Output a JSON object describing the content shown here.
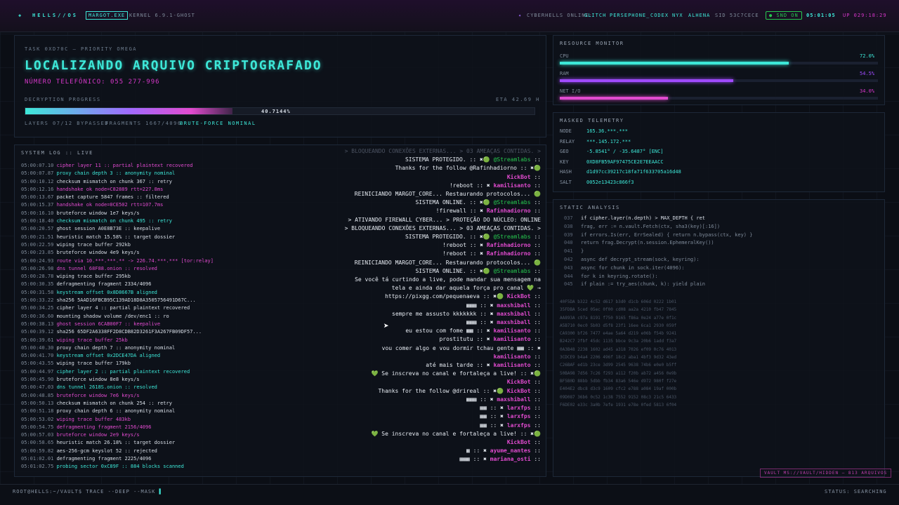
{
  "topbar": {
    "logo": "HELLS//OS",
    "app_badge": "MARGOT.EXE",
    "kernel": "KERNEL 6.9.1-GHOST",
    "online_label": "CYBERHELLS ONLINE:",
    "online_users": [
      "GLITCH",
      "PERSEPHONE_",
      "CODEX",
      "NYX",
      "ALHENA"
    ],
    "sid": "SID 53C7CECE",
    "snd": "SND ON",
    "clock": "05:01:05",
    "uptime": "UP 029:18:29"
  },
  "task": {
    "header": "TASK 0XD70C — PRIORITY OMEGA",
    "title": "LOCALIZANDO ARQUIVO CRIPTOGRAFADO",
    "phone": "NÚMERO TELEFÔNICO: 055 277-996",
    "progress_label": "DECRYPTION PROGRESS",
    "eta": "ETA 42.69 H",
    "progress_value": 40.7144,
    "progress_text": "40.7144%",
    "layers": "LAYERS 07/12 BYPASSED",
    "fragments": "FRAGMENTS 1667/4096",
    "status": "BRUTE-FORCE NOMINAL"
  },
  "log": {
    "header": "SYSTEM LOG :: LIVE",
    "lines": [
      [
        "05:00:07.10",
        "cipher layer 11 :: partial plaintext recovered",
        "mag"
      ],
      [
        "05:00:07.87",
        "proxy chain depth 3 :: anonymity nominal",
        "cyan"
      ],
      [
        "05:00:10.12",
        "checksum mismatch on chunk 367 :: retry",
        "w"
      ],
      [
        "05:00:12.16",
        "handshake ok node=C82889 rtt=227.8ms",
        "mag"
      ],
      [
        "05:00:13.67",
        "packet capture 5847 frames :: filtered",
        "w"
      ],
      [
        "05:00:15.37",
        "handshake ok node=0CE502 rtt=107.7ms",
        "mag"
      ],
      [
        "05:00:16.10",
        "bruteforce window 1e7 keys/s",
        "w"
      ],
      [
        "05:00:18.40",
        "checksum mismatch on chunk 495 :: retry",
        "cyan"
      ],
      [
        "05:00:20.57",
        "ghost session A0E8B73E :: keepalive",
        "w"
      ],
      [
        "05:00:21.51",
        "heuristic match 15.58% :: target dossier",
        "w"
      ],
      [
        "05:00:22.59",
        "wiping trace buffer 292kb",
        "w"
      ],
      [
        "05:00:23.85",
        "bruteforce window 4e9 keys/s",
        "w"
      ],
      [
        "05:00:24.93",
        "route via 10.***.***.** -> 226.74.***.*** [tor:relay]",
        "mag"
      ],
      [
        "05:00:26.98",
        "dns tunnel 68F88.onion :: resolved",
        "mag"
      ],
      [
        "05:00:28.78",
        "wiping trace buffer 295kb",
        "w"
      ],
      [
        "05:00:30.35",
        "defragmenting fragment 2334/4096",
        "w"
      ],
      [
        "05:00:31.58",
        "keystream offset 0x8D8667B aligned",
        "cyan"
      ],
      [
        "05:00:33.22",
        "sha256 5AAD16FBCB95C139AD18D8A3505756491D67C...",
        "w"
      ],
      [
        "05:00:34.25",
        "cipher layer 4 :: partial plaintext recovered",
        "w"
      ],
      [
        "05:00:36.60",
        "mounting shadow volume /dev/enc1 :: ro",
        "w"
      ],
      [
        "05:00:38.13",
        "ghost session 6CAB00F7 :: keepalive",
        "mag"
      ],
      [
        "05:00:39.12",
        "sha256 65DF2A6338FF2D8CDB82D3261F3A267FB09DF57...",
        "w"
      ],
      [
        "05:00:39.61",
        "wiping trace buffer 25kb",
        "mag"
      ],
      [
        "05:00:40.30",
        "proxy chain depth 7 :: anonymity nominal",
        "w"
      ],
      [
        "05:00:41.70",
        "keystream offset 0x2DCE47DA aligned",
        "cyan"
      ],
      [
        "05:00:43.55",
        "wiping trace buffer 179kb",
        "w"
      ],
      [
        "05:00:44.97",
        "cipher layer 2 :: partial plaintext recovered",
        "cyan"
      ],
      [
        "05:00:45.90",
        "bruteforce window 8e8 keys/s",
        "w"
      ],
      [
        "05:00:47.03",
        "dns tunnel 2618S.onion :: resolved",
        "cyan"
      ],
      [
        "05:00:48.85",
        "bruteforce window 7e6 keys/s",
        "mag"
      ],
      [
        "05:00:50.13",
        "checksum mismatch on chunk 254 :: retry",
        "w"
      ],
      [
        "05:00:51.18",
        "proxy chain depth 6 :: anonymity nominal",
        "w"
      ],
      [
        "05:00:53.02",
        "wiping trace buffer 483kb",
        "mag"
      ],
      [
        "05:00:54.75",
        "defragmenting fragment 2156/4096",
        "mag"
      ],
      [
        "05:00:57.03",
        "bruteforce window 2e9 keys/s",
        "mag"
      ],
      [
        "05:00:58.65",
        "heuristic match 26.18% :: target dossier",
        "w"
      ],
      [
        "05:00:59.82",
        "aes-256-gcm keyslot 52 :: rejected",
        "w"
      ],
      [
        "05:01:02.01",
        "defragmenting fragment 2225/4096",
        "w"
      ],
      [
        "05:01:02.75",
        "probing sector 0xC89F :: 884 blocks scanned",
        "cyan"
      ]
    ]
  },
  "chat": [
    [
      "dim",
      "> BLOQUEANDO CONEXÕES EXTERNAS... > 03 AMEAÇAS CONTIDAS. >",
      ""
    ],
    [
      "m",
      "SISTEMA PROTEGIDO. :: ✖🟢",
      "@Streamlabs"
    ],
    [
      "m",
      "Thanks for the follow @Rafinhadiorno :: ✖🟢",
      ""
    ],
    [
      "m",
      "",
      "KickBot"
    ],
    [
      "m",
      "!reboot :: ✖",
      "kamilisanto"
    ],
    [
      "m",
      "REINICIANDO MARGOT_CORE... Restaurando protocolos... 🟢",
      ""
    ],
    [
      "m",
      "SISTEMA ONLINE. :: ✖🟢",
      "@Streamlabs"
    ],
    [
      "m",
      "!firewall :: ✖",
      "Rafinhadiorno"
    ],
    [
      "m",
      "> ATIVANDO FIREWALL CYBER... > PROTEÇÃO DO NÚCLEO: ONLINE",
      ""
    ],
    [
      "m",
      "> BLOQUEANDO CONEXÕES EXTERNAS... > 03 AMEAÇAS CONTIDAS. >",
      ""
    ],
    [
      "m",
      "SISTEMA PROTEGIDO. :: ✖🟢",
      "@Streamlabs"
    ],
    [
      "m",
      "!reboot :: ✖",
      "Rafinhadiorno"
    ],
    [
      "m",
      "!reboot :: ✖",
      "Rafinhadiorno"
    ],
    [
      "m",
      "REINICIANDO MARGOT_CORE... Restaurando protocolos... 🟢",
      ""
    ],
    [
      "m",
      "SISTEMA ONLINE. :: ✖🟢",
      "@Streamlabs"
    ],
    [
      "m",
      "Se você tá curtindo a live, pode mandar sua mensagem na",
      ""
    ],
    [
      "m",
      "tela e ainda dar aquela força pro canal 💚 →",
      ""
    ],
    [
      "m",
      "https://pixgg.com/pequenaeva :: ✖🟢",
      "KickBot"
    ],
    [
      "m",
      "▦▦▦ :: ✖",
      "maxshiball"
    ],
    [
      "m",
      "sempre me assusto kkkkkkk :: ✖",
      "maxshiball"
    ],
    [
      "m",
      "▦▦▦ :: ✖",
      "maxshiball"
    ],
    [
      "m",
      "eu estou com fome ▦▦ :: ✖",
      "kamilisanto"
    ],
    [
      "m",
      "prostitutu :: ✖",
      "kamilisanto"
    ],
    [
      "m",
      "vou comer algo e vou dormir tchau gente ▦▦ :: ✖",
      ""
    ],
    [
      "m",
      "",
      "kamilisanto"
    ],
    [
      "m",
      "até mais tarde :: ✖",
      "kamilisanto"
    ],
    [
      "m",
      "💚 Se inscreva no canal e fortaleça a live! :: ✖🟢",
      ""
    ],
    [
      "m",
      "",
      "KickBot"
    ],
    [
      "m",
      "Thanks for the follow @drireal :: ✖🟢",
      "KickBot"
    ],
    [
      "m",
      "▦▦▦ :: ✖",
      "maxshiball"
    ],
    [
      "m",
      "▦▦ :: ✖",
      "larxfps"
    ],
    [
      "m",
      "▦▦ :: ✖",
      "larxfps"
    ],
    [
      "m",
      "▦▦ :: ✖",
      "larxfps"
    ],
    [
      "m",
      "💚 Se inscreva no canal e fortaleça a live! :: ✖🟢",
      ""
    ],
    [
      "m",
      "",
      "KickBot"
    ],
    [
      "m",
      "▦ :: ✖",
      "ayume_nantes"
    ],
    [
      "m",
      "▦▦▦ :: ✖",
      "mariana_osti"
    ]
  ],
  "resources": {
    "header": "RESOURCE MONITOR",
    "items": [
      {
        "label": "CPU",
        "value": "72.0%",
        "level": 0.72,
        "color": "#3de8d8"
      },
      {
        "label": "RAM",
        "value": "54.5%",
        "level": 0.545,
        "color": "#a04bff"
      },
      {
        "label": "NET I/O",
        "value": "34.0%",
        "level": 0.34,
        "color": "#e24bd0"
      }
    ]
  },
  "telemetry": {
    "header": "MASKED TELEMETRY",
    "rows": [
      [
        "NODE",
        "165.36.***.***"
      ],
      [
        "RELAY",
        "***.145.172.***"
      ],
      [
        "GEO",
        "-5.8541° / -35.6487° [ENC]"
      ],
      [
        "KEY",
        "0XD8FB59AF97475CE2E7EEAACC"
      ],
      [
        "HASH",
        "d1d97cc39217c18fa71f633705a16d48"
      ],
      [
        "SALT",
        "0052e13423c866f3"
      ]
    ]
  },
  "static": {
    "header": "STATIC ANALYSIS",
    "lines": [
      [
        "037",
        "if cipher.layer(n.depth) > MAX_DEPTH { ret"
      ],
      [
        "038",
        "frag, err := n.vault.Fetch(ctx, sha3(key)[:16])"
      ],
      [
        "039",
        "if errors.Is(err, ErrSealed) { return n.bypass(ctx, key) }"
      ],
      [
        "040",
        "return frag.Decrypt(n.session.EphemeralKey())"
      ],
      [
        "041",
        "}"
      ],
      [
        "042",
        "async def decrypt_stream(sock, keyring):"
      ],
      [
        "043",
        "async for chunk in sock.iter(4096):"
      ],
      [
        "044",
        "for k in keyring.rotate():"
      ],
      [
        "045",
        "if plain := try_aes(chunk, k): yield plain"
      ]
    ]
  },
  "hex": [
    "40F5DA b322 4c52 d617 b3d0 d1cb 606d 0222 1b01",
    "35FDBA 5ced 05ec 0f00 cd08 aa2a 4210 fb47 7845",
    "AA893A c97a 8191 f750 9165 f86a 0e24 a77e 0f1c",
    "A5B710 0ec0 5b03 d5f8 23f1 16ee 6ca1 2930 059f",
    "CA9300 bf26 7477 e4ae 5a64 d219 e06b f54b 9241",
    "B242C7 2fbf 45dc 1135 bbce 9c3a 20b6 1add f3a7",
    "0A3B48 2238 1602 ad45 a318 7026 ef09 0c76 4013",
    "3CDCE9 b4a4 2206 496f 18c2 aba1 4bf3 9d32 43ed",
    "C26BAF ed1b 23ce 3d99 2545 9638 74b6 e0e0 b5ff",
    "50BA98 7d56 7c26 f293 a112 f20b ab72 a456 0e9b",
    "BF5B0D 88bb 5dbb fb34 83a6 546e d972 980f f27e",
    "E404E2 dbc8 d3c9 1609 cfc2 e788 a084 19af 000b",
    "09D087 36b6 0c52 1c38 7552 9152 08c3 21c5 6433",
    "F6DE02 e33c 3a0b 7efe 1931 e78e 0fed 5813 6f04"
  ],
  "vault": "VAULT MS://VAULT/HIDDEN — 813 ARQUIVOS",
  "bottombar": {
    "prompt": "ROOT@HELLS:~/VAULT$ TRACE --DEEP --MASK",
    "status": "STATUS: SEARCHING"
  }
}
